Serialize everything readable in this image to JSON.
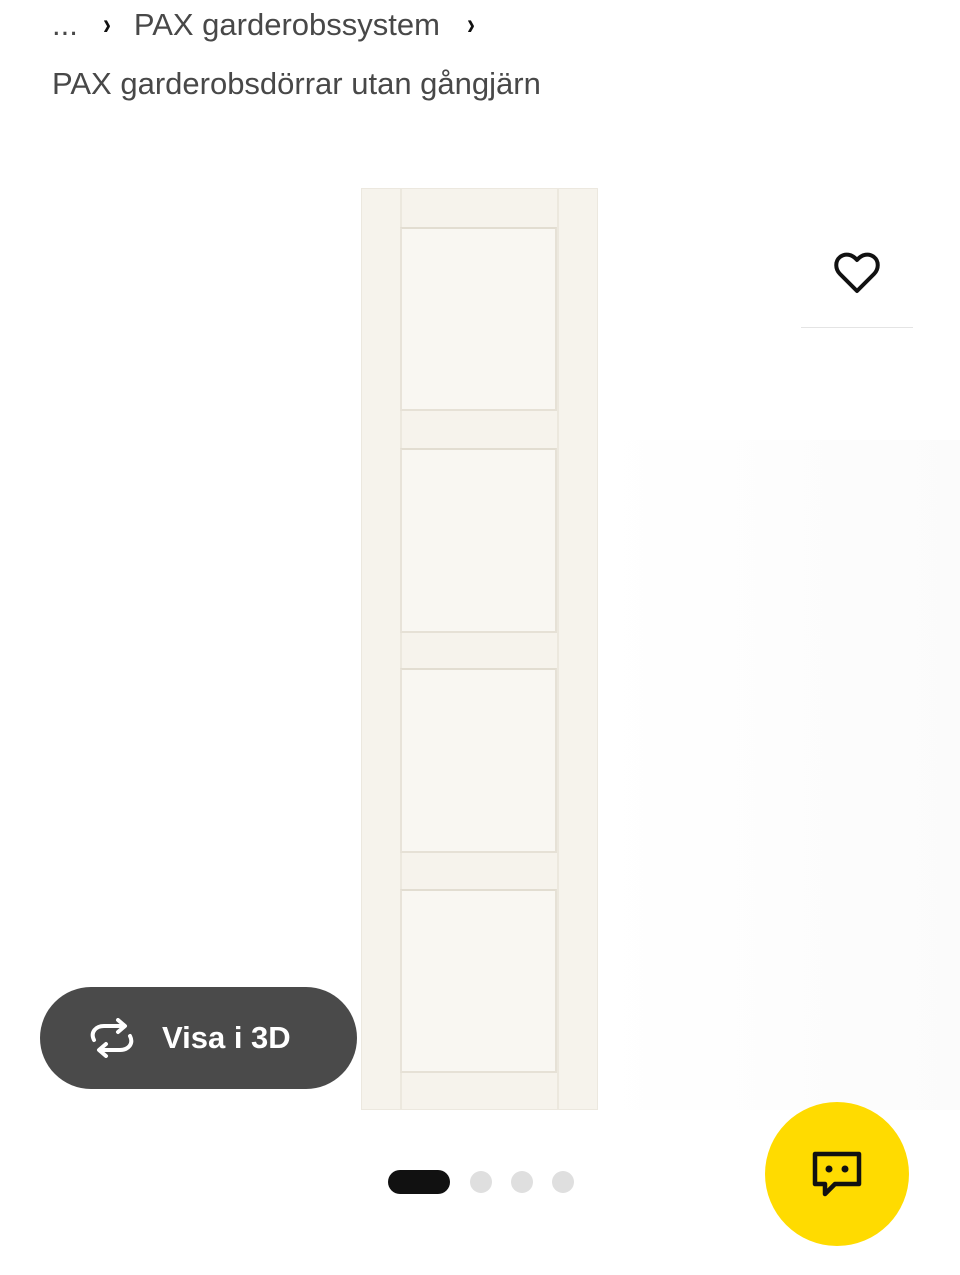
{
  "breadcrumb": {
    "ellipsis": "...",
    "parent": "PAX garderobssystem",
    "separator": "›"
  },
  "page_title": "PAX garderobsdörrar utan gångjärn",
  "gallery": {
    "view_3d_label": "Visa i 3D",
    "image_count": 4,
    "active_index": 0
  },
  "icons": {
    "favourite": "heart-outline-icon",
    "view_3d": "rotate-3d-icon",
    "chat": "chat-bubble-icon"
  },
  "colors": {
    "view_3d_bg": "#4a4a4a",
    "chat_bg": "#ffdb00",
    "active_dot": "#111111",
    "inactive_dot": "#dfdfdf",
    "door": "#f6f3ec"
  }
}
